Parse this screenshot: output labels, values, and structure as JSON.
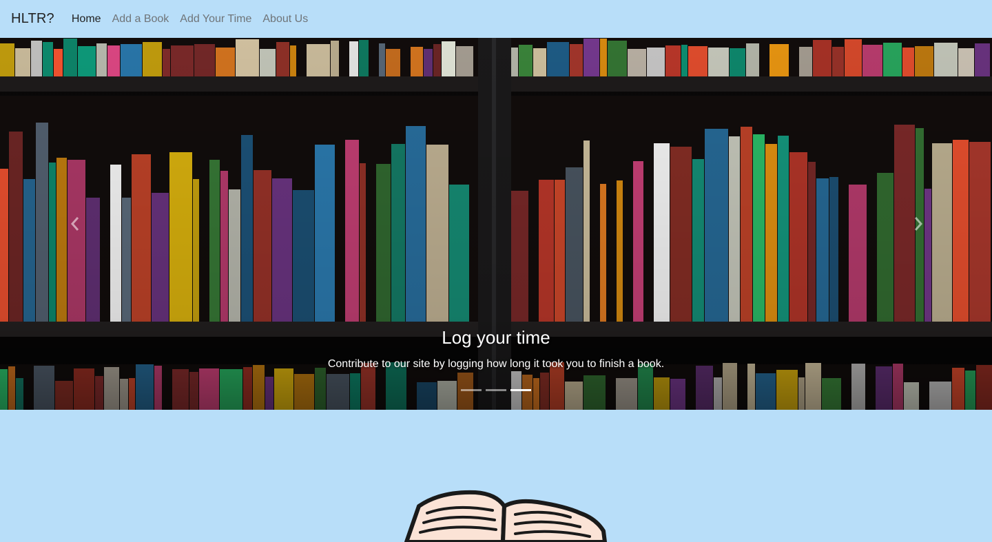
{
  "navbar": {
    "brand": "HLTR?",
    "links": [
      {
        "label": "Home",
        "active": true
      },
      {
        "label": "Add a Book",
        "active": false
      },
      {
        "label": "Add Your Time",
        "active": false
      },
      {
        "label": "About Us",
        "active": false
      }
    ]
  },
  "carousel": {
    "title": "Log your time",
    "text": "Contribute to our site by logging how long it took you to finish a book.",
    "slide_count": 3,
    "active_slide": 3,
    "prev_icon": "chevron-left-icon",
    "next_icon": "chevron-right-icon"
  },
  "colors": {
    "page_background": "#b8def9",
    "nav_text": "#6f7478",
    "nav_active": "#222222"
  }
}
